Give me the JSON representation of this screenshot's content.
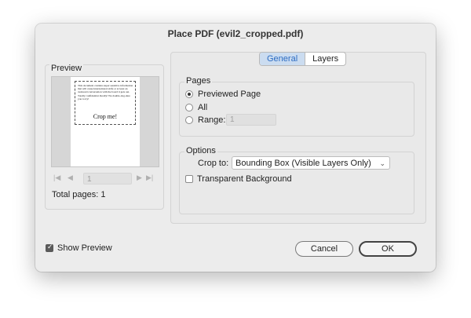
{
  "window": {
    "title": "Place PDF (evil2_cropped.pdf)"
  },
  "preview": {
    "label": "Preview",
    "document_text": "This document contains super sensitive information that will cause international strife or at least an awkward conversation with the board it gets out. Totally confidential. Really! We double-dog-dare you to try!",
    "crop_text": "Crop me!",
    "page_field_value": "1",
    "total_pages": "Total pages: 1"
  },
  "tabs": [
    {
      "label": "General",
      "active": true
    },
    {
      "label": "Layers",
      "active": false
    }
  ],
  "pages": {
    "label": "Pages",
    "options": [
      {
        "label": "Previewed Page",
        "selected": true
      },
      {
        "label": "All",
        "selected": false
      },
      {
        "label": "Range:",
        "selected": false
      }
    ],
    "range_value": "1"
  },
  "options": {
    "label": "Options",
    "crop_to_label": "Crop to:",
    "crop_to_value": "Bounding Box (Visible Layers Only)",
    "transparent_background": {
      "label": "Transparent Background",
      "checked": false
    }
  },
  "show_preview": {
    "label": "Show Preview",
    "checked": true
  },
  "buttons": {
    "cancel": "Cancel",
    "ok": "OK"
  }
}
